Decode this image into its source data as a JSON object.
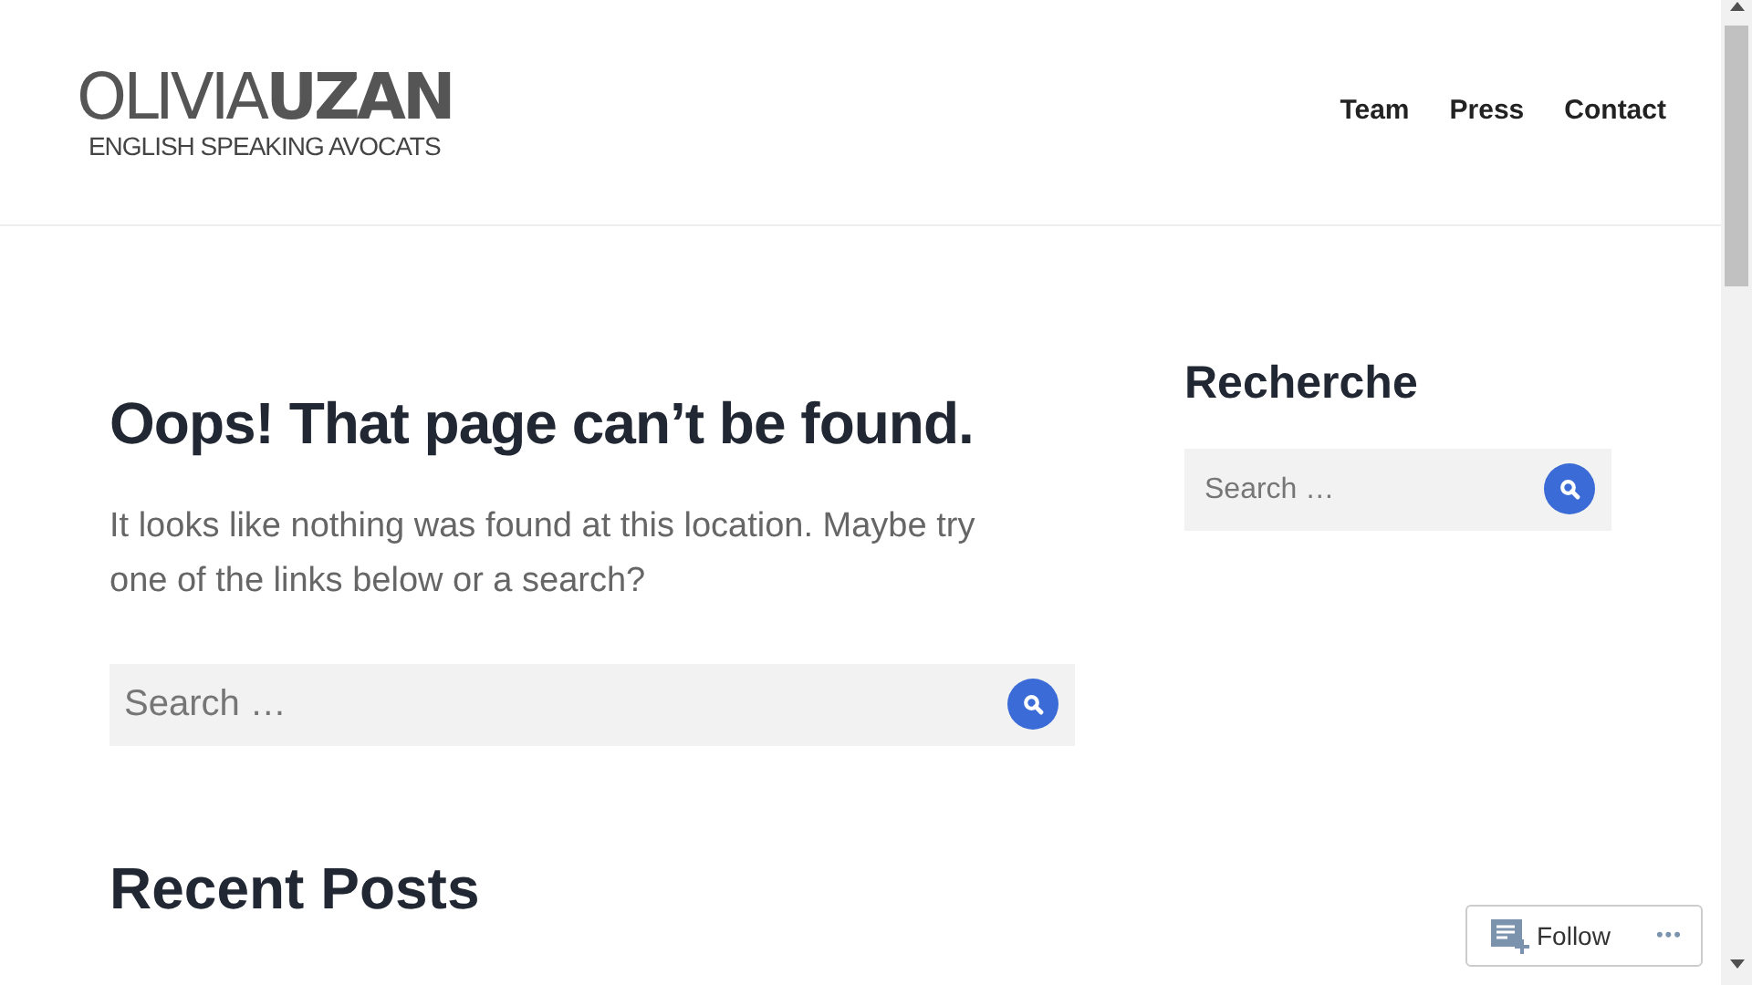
{
  "header": {
    "logo": {
      "name": "OLIVIA**UZAN**",
      "tagline": "ENGLISH SPEAKING AVOCATS"
    },
    "nav": [
      {
        "label": "Team"
      },
      {
        "label": "Press"
      },
      {
        "label": "Contact"
      }
    ]
  },
  "main": {
    "title": "Oops! That page can’t be found.",
    "message": "It looks like nothing was found at this location. Maybe try one of the links below or a search?",
    "search": {
      "placeholder": "Search …"
    },
    "recent_heading": "Recent Posts"
  },
  "sidebar": {
    "heading": "Recherche",
    "search": {
      "placeholder": "Search …"
    }
  },
  "follow_button": {
    "label": "Follow",
    "more": "•••"
  }
}
